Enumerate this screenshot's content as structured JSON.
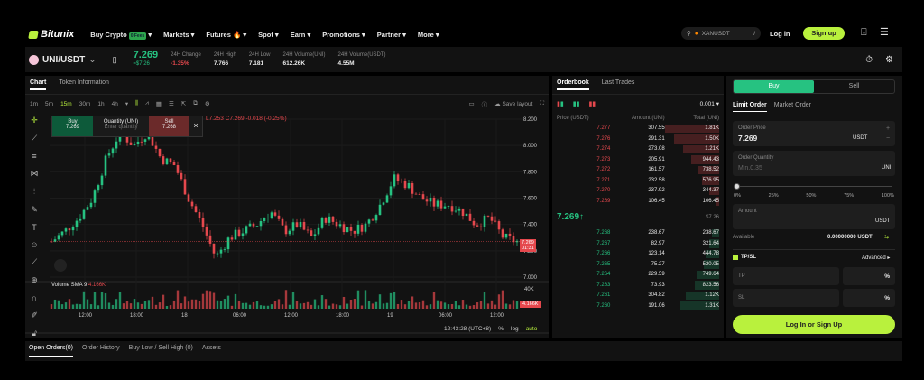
{
  "nav": {
    "brand": "Bitunix",
    "items": [
      {
        "label": "Buy Crypto",
        "badge": "0 Fees"
      },
      {
        "label": "Markets"
      },
      {
        "label": "Futures 🔥"
      },
      {
        "label": "Spot"
      },
      {
        "label": "Earn"
      },
      {
        "label": "Promotions"
      },
      {
        "label": "Partner"
      },
      {
        "label": "More"
      }
    ],
    "search_value": "XANUSDT",
    "search_shortcut": "/",
    "login": "Log in",
    "signup": "Sign up"
  },
  "ticker": {
    "pair": "UNI/USDT",
    "price": "7.269",
    "price_usd": "≈$7.26",
    "stats": [
      {
        "label": "24H Change",
        "value": "-1.35%"
      },
      {
        "label": "24H High",
        "value": "7.766"
      },
      {
        "label": "24H Low",
        "value": "7.181"
      },
      {
        "label": "24H Volume(UNI)",
        "value": "612.26K"
      },
      {
        "label": "24H Volume(USDT)",
        "value": "4.55M"
      }
    ]
  },
  "chart_panel": {
    "tabs": [
      "Chart",
      "Token Information"
    ],
    "intervals": [
      "1m",
      "5m",
      "15m",
      "30m",
      "1h",
      "4h"
    ],
    "active_interval": "15m",
    "save_layout": "Save layout",
    "quick": {
      "buy": "Buy",
      "buy_price": "7.269",
      "qty_label": "Quantity (UNI)",
      "qty_placeholder": "Enter quantity",
      "sell": "Sell",
      "sell_price": "7.268"
    },
    "ohlc": "L7.253 C7.269 -0.018 (-0.25%)",
    "volume_label": "Volume SMA 9",
    "volume_value": "4.166K",
    "last_price": "7.269",
    "countdown": "01:31",
    "time": "12:43:28 (UTC+8)",
    "pct": "%",
    "log": "log",
    "auto": "auto"
  },
  "chart_data": {
    "type": "candlestick",
    "y_ticks": [
      "8.200",
      "8.000",
      "7.800",
      "7.600",
      "7.400",
      "7.200",
      "7.000"
    ],
    "ylim": [
      7.0,
      8.2
    ],
    "x_ticks": [
      "12:00",
      "18:00",
      "18",
      "06:00",
      "12:00",
      "18:00",
      "19",
      "06:00",
      "12:00"
    ],
    "volume_ticks": [
      "40K"
    ],
    "close_path": [
      7.27,
      7.35,
      7.45,
      7.6,
      7.9,
      8.1,
      8.0,
      8.1,
      7.9,
      7.85,
      7.6,
      7.4,
      7.15,
      7.3,
      7.35,
      7.4,
      7.5,
      7.35,
      7.4,
      7.3,
      7.45,
      7.4,
      7.35,
      7.4,
      7.55,
      7.75,
      7.7,
      7.6,
      7.55,
      7.55,
      7.5,
      7.4,
      7.45,
      7.3,
      7.27
    ]
  },
  "orderbook": {
    "tabs": [
      "Orderbook",
      "Last Trades"
    ],
    "precision": "0.001",
    "headers": [
      "Price (USDT)",
      "Amount (UNI)",
      "Total (UNI)"
    ],
    "asks": [
      [
        "7.277",
        "307.55",
        "1.81K"
      ],
      [
        "7.276",
        "291.31",
        "1.50K"
      ],
      [
        "7.274",
        "273.08",
        "1.21K"
      ],
      [
        "7.273",
        "205.91",
        "944.43"
      ],
      [
        "7.272",
        "161.57",
        "738.52"
      ],
      [
        "7.271",
        "232.58",
        "576.95"
      ],
      [
        "7.270",
        "237.92",
        "344.37"
      ],
      [
        "7.269",
        "106.45",
        "106.45"
      ]
    ],
    "mid_price": "7.269↑",
    "mid_usd": "$7.26",
    "bids": [
      [
        "7.268",
        "238.67",
        "238.67"
      ],
      [
        "7.267",
        "82.97",
        "321.64"
      ],
      [
        "7.266",
        "123.14",
        "444.78"
      ],
      [
        "7.265",
        "75.27",
        "520.05"
      ],
      [
        "7.264",
        "229.59",
        "749.64"
      ],
      [
        "7.263",
        "73.93",
        "823.56"
      ],
      [
        "7.261",
        "304.82",
        "1.12K"
      ],
      [
        "7.260",
        "191.06",
        "1.31K"
      ]
    ]
  },
  "trade": {
    "buy": "Buy",
    "sell": "Sell",
    "tabs": [
      "Limit Order",
      "Market Order"
    ],
    "order_price_label": "Order Price",
    "order_price": "7.269",
    "usdt": "USDT",
    "qty_label": "Order Quantity",
    "qty_placeholder": "Min.0.35",
    "uni": "UNI",
    "slider_marks": [
      "0%",
      "25%",
      "50%",
      "75%",
      "100%"
    ],
    "slider_value": 0,
    "amount_label": "Amount",
    "available_label": "Available",
    "available": "0.00000000 USDT",
    "tpsl": "TP/SL",
    "advanced": "Advanced ▸",
    "tp": "TP",
    "sl": "SL",
    "percent": "%",
    "cta": "Log In or Sign Up"
  },
  "bottom": {
    "tabs": [
      "Open Orders(0)",
      "Order History",
      "Buy Low / Sell High (0)",
      "Assets"
    ]
  },
  "colors": {
    "up": "#26c281",
    "down": "#e5484d",
    "accent": "#b9f13d"
  }
}
